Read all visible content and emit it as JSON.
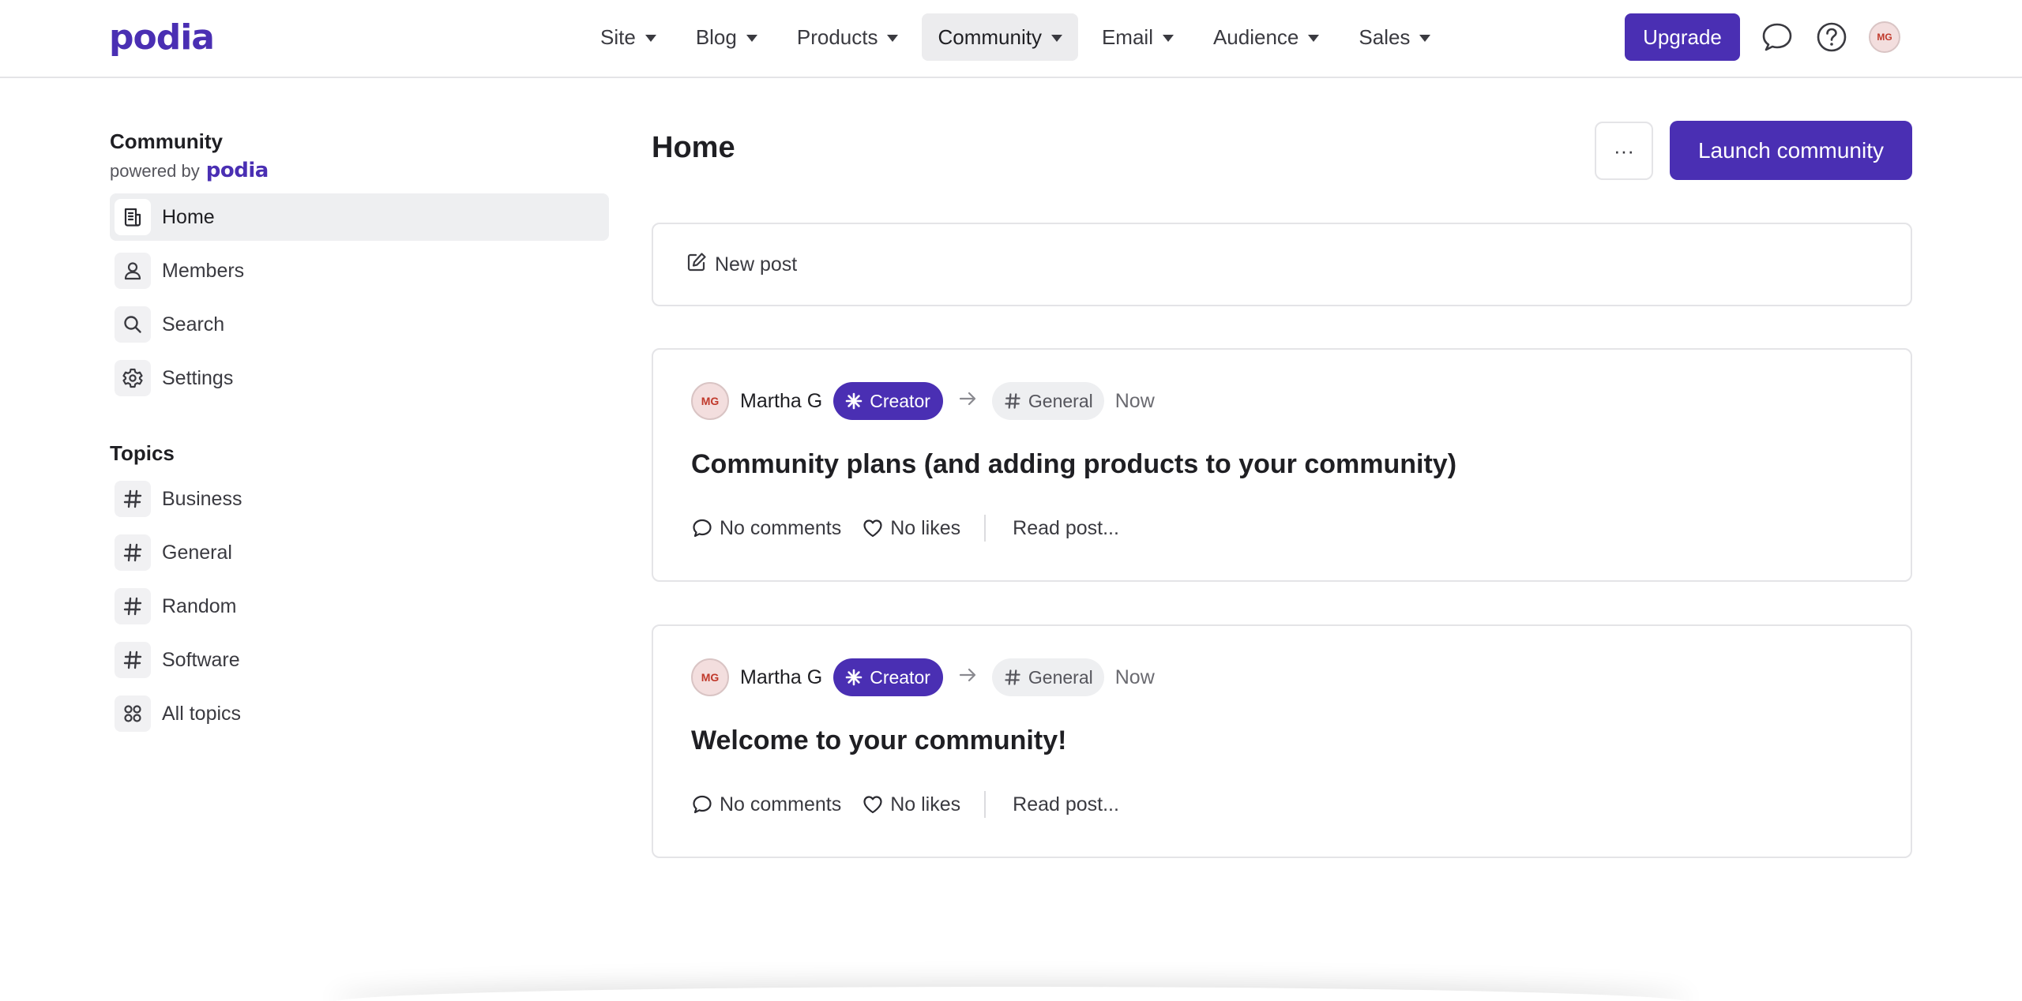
{
  "brand": {
    "logo_text": "podia",
    "accent": "#4a2fb3"
  },
  "nav": {
    "items": [
      {
        "label": "Site"
      },
      {
        "label": "Blog"
      },
      {
        "label": "Products"
      },
      {
        "label": "Community",
        "active": true
      },
      {
        "label": "Email"
      },
      {
        "label": "Audience"
      },
      {
        "label": "Sales"
      }
    ],
    "upgrade_label": "Upgrade",
    "user_initials": "MG"
  },
  "sidebar": {
    "title": "Community",
    "powered_by": "powered by",
    "powered_logo": "podia",
    "items": [
      {
        "label": "Home",
        "icon": "document-icon",
        "active": true
      },
      {
        "label": "Members",
        "icon": "user-icon"
      },
      {
        "label": "Search",
        "icon": "search-icon"
      },
      {
        "label": "Settings",
        "icon": "gear-icon"
      }
    ],
    "topics_title": "Topics",
    "topics": [
      {
        "label": "Business",
        "icon": "hash-icon"
      },
      {
        "label": "General",
        "icon": "hash-icon"
      },
      {
        "label": "Random",
        "icon": "hash-icon"
      },
      {
        "label": "Software",
        "icon": "hash-icon"
      },
      {
        "label": "All topics",
        "icon": "grid-icon"
      }
    ]
  },
  "main": {
    "title": "Home",
    "more_label": "···",
    "launch_label": "Launch community",
    "new_post_label": "New post",
    "posts": [
      {
        "author_initials": "MG",
        "author": "Martha G",
        "badge": "Creator",
        "topic": "General",
        "time": "Now",
        "title": "Community plans (and adding products to your community)",
        "comments": "No comments",
        "likes": "No likes",
        "read": "Read post..."
      },
      {
        "author_initials": "MG",
        "author": "Martha G",
        "badge": "Creator",
        "topic": "General",
        "time": "Now",
        "title": "Welcome to your community!",
        "comments": "No comments",
        "likes": "No likes",
        "read": "Read post..."
      }
    ]
  }
}
